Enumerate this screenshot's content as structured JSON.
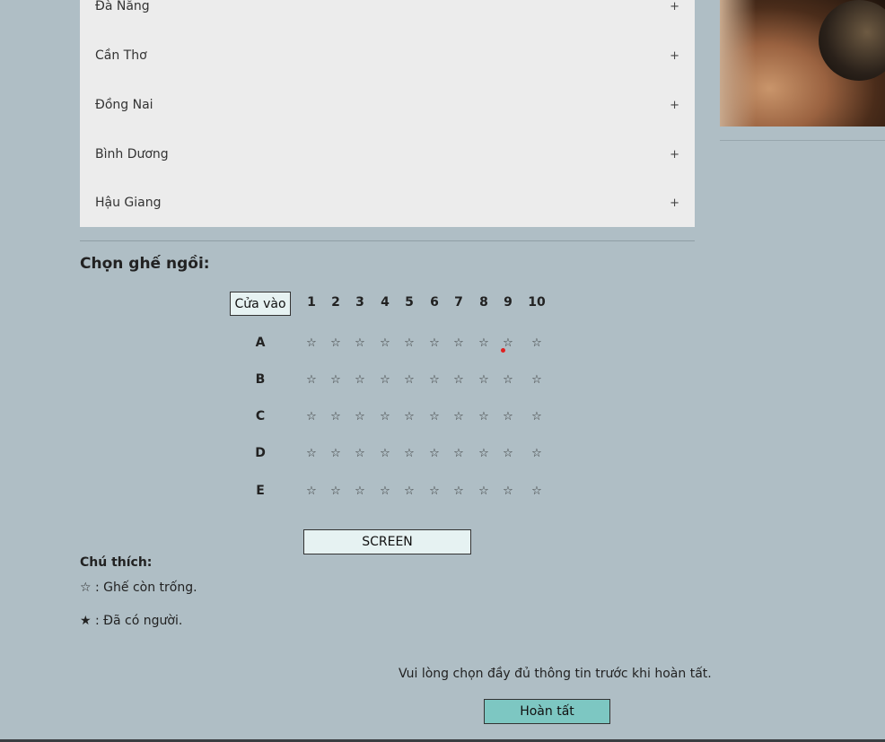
{
  "cities": [
    {
      "label": "Đà Nẵng",
      "toggle": "+"
    },
    {
      "label": "Cần Thơ",
      "toggle": "+"
    },
    {
      "label": "Đồng Nai",
      "toggle": "+"
    },
    {
      "label": "Bình Dương",
      "toggle": "+"
    },
    {
      "label": "Hậu Giang",
      "toggle": "+"
    }
  ],
  "seat_section": {
    "title": "Chọn ghế ngồi:",
    "entrance_label": "Cửa vào",
    "columns": [
      "1",
      "2",
      "3",
      "4",
      "5",
      "6",
      "7",
      "8",
      "9",
      "10"
    ],
    "rows": [
      "A",
      "B",
      "C",
      "D",
      "E"
    ],
    "empty_seat_symbol": "☆",
    "screen_label": "SCREEN"
  },
  "legend": {
    "title": "Chú thích:",
    "empty": "☆ : Ghế còn trống.",
    "taken": "★ : Đã có người."
  },
  "footer": {
    "notice": "Vui lòng chọn đầy đủ thông tin trước khi hoàn tất.",
    "finish_label": "Hoàn tất"
  },
  "colors": {
    "page_bg": "#afbec5",
    "panel_bg": "#ececec",
    "box_bg": "#e6f2f2",
    "button_bg": "#7dc7c2"
  }
}
